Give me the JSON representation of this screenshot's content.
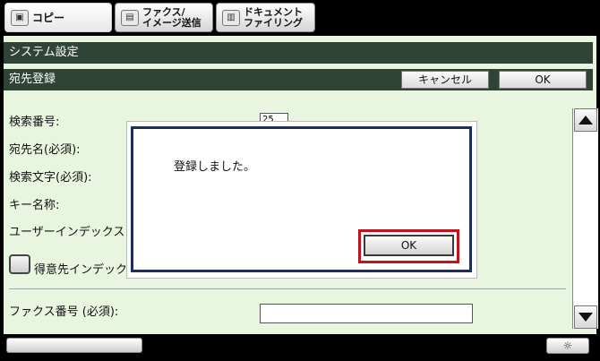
{
  "tabs": [
    {
      "label": "コピー",
      "icon": "copy-icon"
    },
    {
      "label": "ファクス/\nイメージ送信",
      "icon": "fax-icon"
    },
    {
      "label": "ドキュメント\nファイリング",
      "icon": "document-filing-icon"
    }
  ],
  "header": {
    "system_title": "システム設定",
    "section_title": "宛先登録",
    "cancel_label": "キャンセル",
    "ok_label": "OK"
  },
  "form": {
    "search_number_label": "検索番号:",
    "search_number_value": "25",
    "address_name_label": "宛先名(必須):",
    "search_chars_label": "検索文字(必須):",
    "key_name_label": "キー名称:",
    "user_index_label": "ユーザーインデックス",
    "favorite_index_label": "得意先インデック",
    "fax_number_label": "ファクス番号 (必須):"
  },
  "dialog": {
    "message": "登録しました。",
    "ok_label": "OK"
  },
  "footer": {
    "right_icon": "☼"
  }
}
